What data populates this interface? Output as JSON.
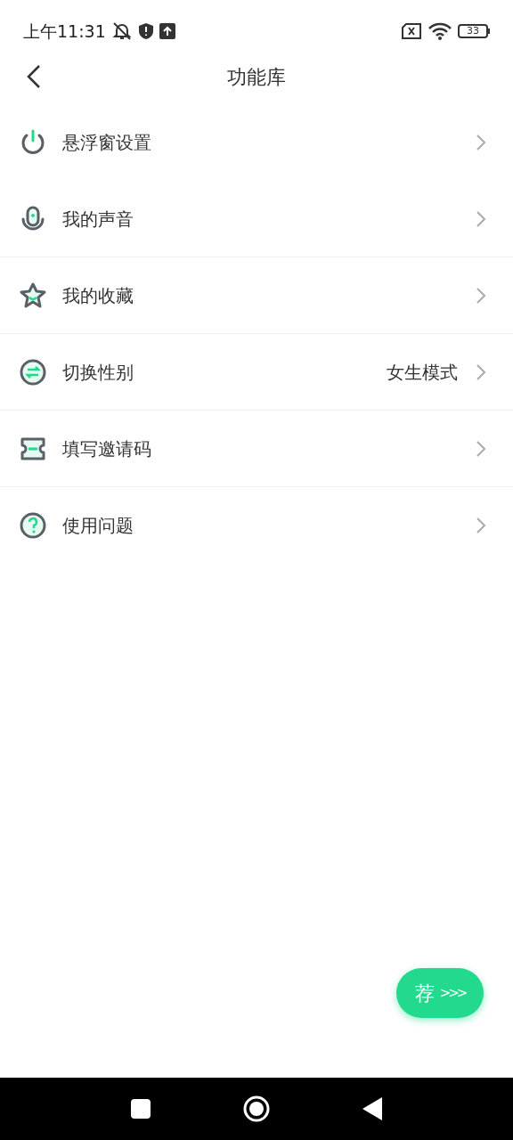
{
  "status_bar": {
    "time": "上午11:31",
    "battery": "33"
  },
  "header": {
    "title": "功能库"
  },
  "items": [
    {
      "kind": "power",
      "label": "悬浮窗设置",
      "divider": false
    },
    {
      "kind": "mic",
      "label": "我的声音",
      "divider": true
    },
    {
      "kind": "star",
      "label": "我的收藏",
      "divider": true
    },
    {
      "kind": "swap",
      "label": "切换性别",
      "value": "女生模式",
      "divider": true
    },
    {
      "kind": "ticket",
      "label": "填写邀请码",
      "divider": true
    },
    {
      "kind": "question",
      "label": "使用问题",
      "divider": false
    }
  ],
  "float_button": {
    "label": "荐",
    "arrows": ">>>"
  }
}
